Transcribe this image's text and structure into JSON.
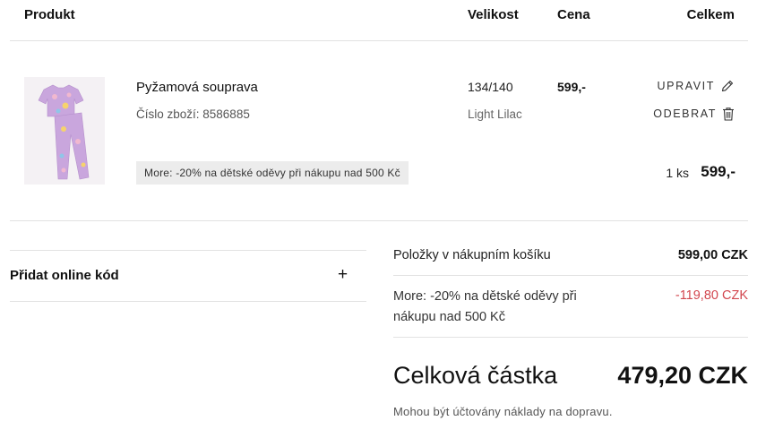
{
  "header": {
    "product": "Produkt",
    "size": "Velikost",
    "price": "Cena",
    "total": "Celkem"
  },
  "item": {
    "image_icon": "pajama-set-image",
    "name": "Pyžamová souprava",
    "sku_label": "Číslo zboží: 8586885",
    "promo": "More: -20% na dětské oděvy při nákupu nad 500 Kč",
    "size": "134/140",
    "color_name": "Light Lilac",
    "price": "599,-",
    "edit_label": "UPRAVIT",
    "edit_icon": "pencil-icon",
    "remove_label": "ODEBRAT",
    "remove_icon": "trash-icon",
    "quantity": "1 ks",
    "line_total": "599,-"
  },
  "coupon": {
    "label": "Přidat online kód",
    "toggle": "+"
  },
  "summary": {
    "items_label": "Položky v nákupním košíku",
    "items_value": "599,00 CZK",
    "discount_label": "More: -20% na dětské oděvy při nákupu nad 500 Kč",
    "discount_value": "-119,80 CZK",
    "total_label": "Celková částka",
    "total_value": "479,20 CZK",
    "shipping_note": "Mohou být účtovány náklady na dopravu."
  },
  "colors": {
    "discount": "#d2474f",
    "divider": "#e2e2e2",
    "promo_background": "#ececec",
    "product_lilac": "#c9a6dd"
  }
}
